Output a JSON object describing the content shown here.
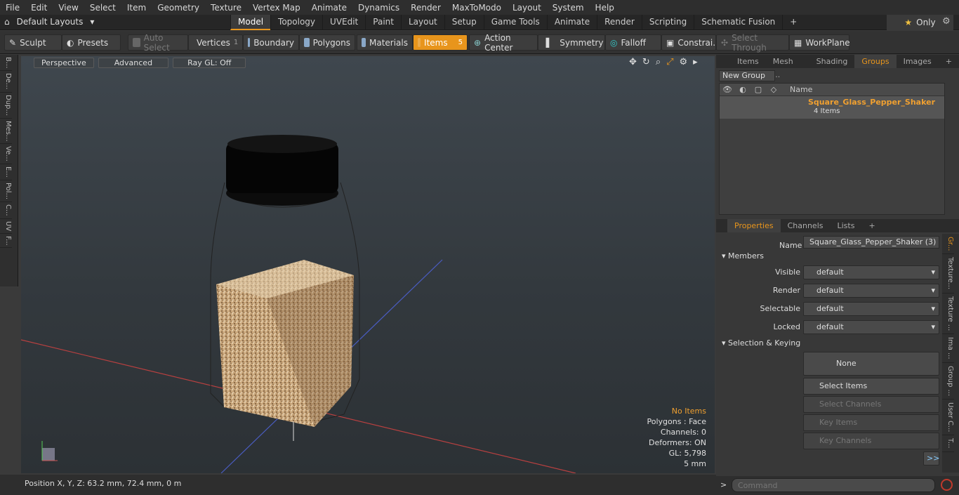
{
  "menu": [
    "File",
    "Edit",
    "View",
    "Select",
    "Item",
    "Geometry",
    "Texture",
    "Vertex Map",
    "Animate",
    "Dynamics",
    "Render",
    "MaxToModo",
    "Layout",
    "System",
    "Help"
  ],
  "layouts": "Default Layouts",
  "tabs": [
    "Model",
    "Topology",
    "UVEdit",
    "Paint",
    "Layout",
    "Setup",
    "Game Tools",
    "Animate",
    "Render",
    "Scripting",
    "Schematic Fusion",
    "+"
  ],
  "only": "Only",
  "toolbar": {
    "sculpt": "Sculpt",
    "presets": "Presets",
    "auto_select": "Auto Select",
    "vertices": "Vertices",
    "vertices_count": "1",
    "boundary": "Boundary",
    "polygons": "Polygons",
    "materials": "Materials",
    "items": "Items",
    "items_count": "5",
    "action_center": "Action Center",
    "symmetry": "Symmetry",
    "falloff": "Falloff",
    "constraints": "Constrai...",
    "select_through": "Select Through",
    "workplane": "WorkPlane"
  },
  "lefttabs": [
    "B...",
    "De...",
    "Dup...",
    "Mes...",
    "Ve...",
    "E...",
    "Pol...",
    "C...",
    "UV",
    "F..."
  ],
  "viewport": {
    "perspective": "Perspective",
    "advanced": "Advanced",
    "raygl": "Ray GL: Off",
    "info": {
      "no_items": "No Items",
      "polygons": "Polygons : Face",
      "channels": "Channels: 0",
      "deformers": "Deformers: ON",
      "gl": "GL: 5,798",
      "unit": "5 mm"
    }
  },
  "status": "Position X, Y, Z:   63.2 mm, 72.4 mm, 0 m",
  "rtabs": [
    "Items",
    "Mesh ...",
    "Shading",
    "Groups",
    "Images",
    "+"
  ],
  "new_group": "New Group",
  "list_header": "Name",
  "group_name": "Square_Glass_Pepper_Shaker",
  "group_items": "4 Items",
  "ptabs": [
    "Properties",
    "Channels",
    "Lists",
    "+"
  ],
  "props": {
    "name_label": "Name",
    "name_value": "Square_Glass_Pepper_Shaker (3)",
    "members": "Members",
    "visible": "Visible",
    "render": "Render",
    "selectable": "Selectable",
    "locked": "Locked",
    "default": "default",
    "sel_keying": "Selection & Keying",
    "none": "None",
    "select_items": "Select Items",
    "select_channels": "Select Channels",
    "key_items": "Key Items",
    "key_channels": "Key Channels",
    "more": ">>"
  },
  "vtabs": [
    "Gr...",
    "Texture...",
    "Texture ...",
    "Ima ...",
    "Group ...",
    "User C...",
    "T..."
  ],
  "command_placeholder": "Command"
}
